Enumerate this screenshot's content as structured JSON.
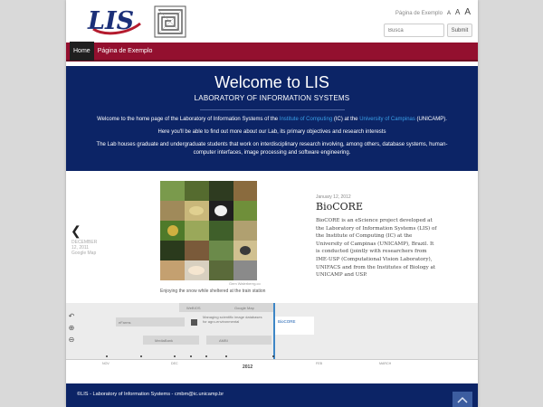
{
  "header": {
    "logo_text": "LIS",
    "font_controls": {
      "label": "Página de Exemplo",
      "a_small": "A",
      "a_medium": "A",
      "a_large": "A"
    },
    "search": {
      "placeholder": "Busca",
      "submit_label": "Submit"
    }
  },
  "nav": {
    "items": [
      {
        "label": "Home",
        "active": true
      },
      {
        "label": "Página de Exemplo",
        "active": false
      }
    ]
  },
  "hero": {
    "title": "Welcome to LIS",
    "subtitle": "LABORATORY OF INFORMATION SYSTEMS",
    "p1_before": "Welcome to the home page of the Laboratory of Information Systems of the ",
    "p1_link1": "Institute of Computing",
    "p1_mid": " (IC) at the ",
    "p1_link2": "University of Campinas",
    "p1_after": " (UNICAMP).",
    "p2": "Here you'll be able to find out more about our Lab, its primary objectives and research interests",
    "p3": "The Lab houses graduate and undergraduate students that work on interdisciplinary research involving, among others, database systems, human-computer interfaces, image processing and software engineering."
  },
  "slide": {
    "prev_date": "DECEMBER 12, 2011",
    "prev_title": "Google Map",
    "image_credit": "Gem Walerberrg.co",
    "caption": "Enjoying the snow while sheltered at the train station",
    "date": "January 12, 2012",
    "title": "BioCORE",
    "body": "BioCORE is an eScience project developed at the Laboratory of Information Systems (LIS) of the Institute of Computing (IC) at the University of Campinas (UNICAMP), Brazil. It is conducted (jointly with researchers from IME-USP (Computational Vision Laboratory), UNIFACS and from the Institutes of Biology at UNICAMP and USP."
  },
  "timeline": {
    "events": [
      "WeBIOS",
      "Google Map",
      "eFarms",
      "Managing scientific image databases for agro-environmental",
      "MediaBank",
      "AMBI",
      "BioCORE"
    ],
    "months": [
      "NOV",
      "DEC",
      "FEB",
      "MARCH"
    ],
    "year": "2012"
  },
  "footer": {
    "text": "©LIS - Laboratory of Information Systems - cmbm@ic.unicamp.br"
  },
  "colors": {
    "navy": "#0c2466",
    "crimson": "#93102f",
    "link": "#3aa0e8",
    "timeline_accent": "#3d86c6"
  }
}
